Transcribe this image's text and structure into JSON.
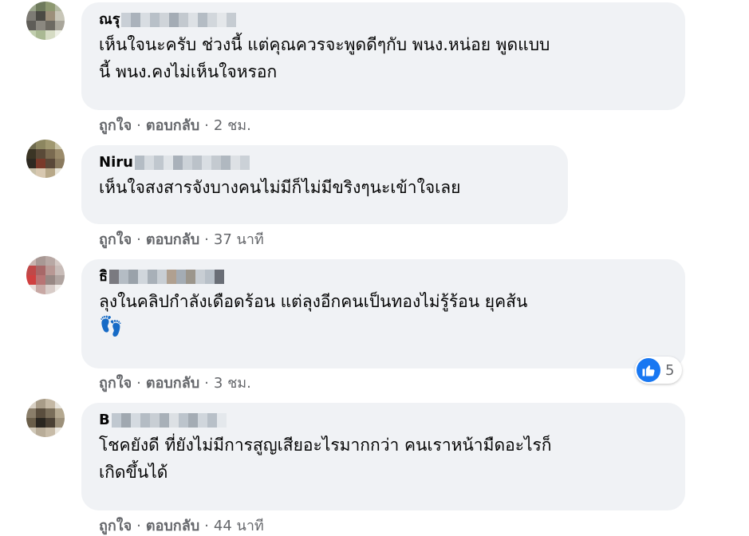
{
  "comments": [
    {
      "author_visible": "ณรุ",
      "text": "เห็นใจนะครับ ช่วงนี้ แต่คุณควรจะพูดดีๆกับ พนง.หน่อย พูดแบบ\nนี้ พนง.คงไม่เห็นใจหรอก",
      "like_label": "ถูกใจ",
      "reply_label": "ตอบกลับ",
      "time": "2 ชม."
    },
    {
      "author_visible": "Niru",
      "text": "เห็นใจสงสารจังบางคนไม่มีก็ไม่มีขริงๆนะเข้าใจเลย",
      "like_label": "ถูกใจ",
      "reply_label": "ตอบกลับ",
      "time": "37 นาที"
    },
    {
      "author_visible": "ธิ",
      "text": "ลุงในคลิปกำลังเดือดร้อน แต่ลุงอีกคนเป็นทองไม่รู้ร้อน ยุคส้น",
      "emoji": "👣",
      "like_label": "ถูกใจ",
      "reply_label": "ตอบกลับ",
      "time": "3 ชม.",
      "reaction_count": "5"
    },
    {
      "author_visible": "B",
      "text": "โชคยังดี ที่ยังไม่มีการสูญเสียอะไรมากกว่า คนเราหน้ามืดอะไรก็\nเกิดขึ้นได้",
      "like_label": "ถูกใจ",
      "reply_label": "ตอบกลับ",
      "time": "44 นาที"
    }
  ],
  "separator": "·",
  "colors": {
    "bubble": "#f0f2f5",
    "meta": "#65676b",
    "like_blue": "#1877f2"
  }
}
